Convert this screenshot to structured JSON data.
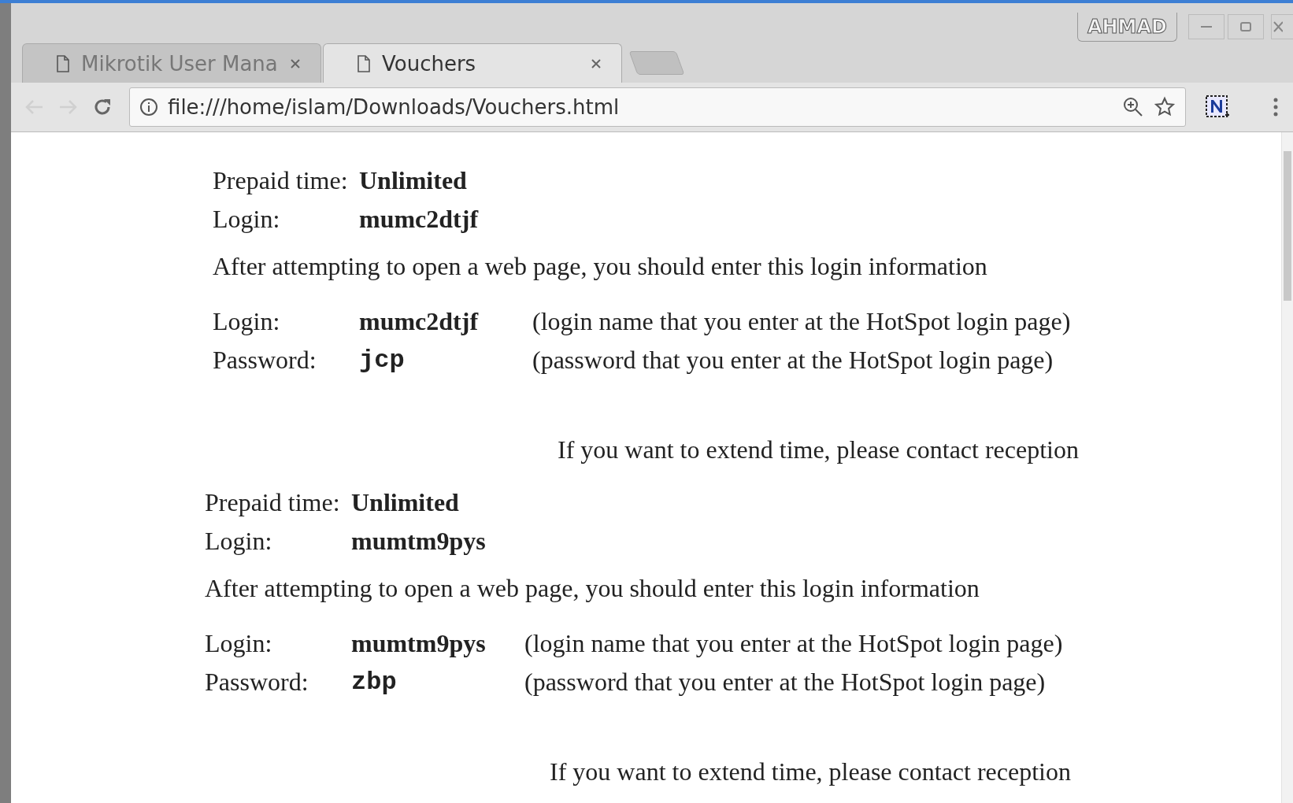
{
  "window": {
    "user_badge": "AHMAD"
  },
  "tabs": [
    {
      "title": "Mikrotik User Mana",
      "selected": false
    },
    {
      "title": "Vouchers",
      "selected": true
    }
  ],
  "address_bar": {
    "url": "file:///home/islam/Downloads/Vouchers.html"
  },
  "vouchers": [
    {
      "prepaid_label": "Prepaid time:",
      "prepaid_value": "Unlimited",
      "login_label": "Login:",
      "login_value": "mumc2dtjf",
      "instruction": "After attempting to open a web page, you should enter this login information",
      "credentials": [
        {
          "kind": "login",
          "label": "Login:",
          "value": "mumc2dtjf",
          "note": "(login name that you enter at the HotSpot login page)"
        },
        {
          "kind": "password",
          "label": "Password:",
          "value": "jcp",
          "note": "(password that you enter at the HotSpot login page)"
        }
      ],
      "footer": "If you want to extend time, please contact reception"
    },
    {
      "prepaid_label": "Prepaid time:",
      "prepaid_value": "Unlimited",
      "login_label": "Login:",
      "login_value": "mumtm9pys",
      "instruction": "After attempting to open a web page, you should enter this login information",
      "credentials": [
        {
          "kind": "login",
          "label": "Login:",
          "value": "mumtm9pys",
          "note": "(login name that you enter at the HotSpot login page)"
        },
        {
          "kind": "password",
          "label": "Password:",
          "value": "zbp",
          "note": "(password that you enter at the HotSpot login page)"
        }
      ],
      "footer": "If you want to extend time, please contact reception"
    }
  ]
}
